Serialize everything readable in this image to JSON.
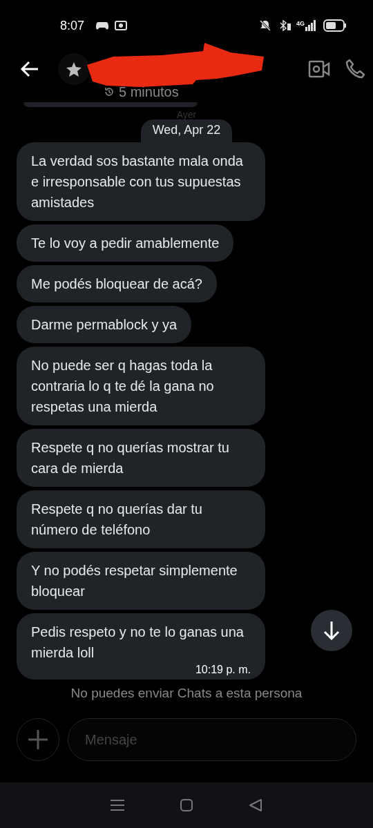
{
  "status_bar": {
    "time": "8:07",
    "network": "4G"
  },
  "header": {
    "subtitle": "5 minutos"
  },
  "date_divider": {
    "label_behind": "Ayer",
    "label": "Wed, Apr 22"
  },
  "messages": [
    {
      "text": "La verdad sos bastante mala onda e irresponsable con tus supuestas amistades"
    },
    {
      "text": "Te lo voy a pedir amablemente"
    },
    {
      "text": "Me podés bloquear de acá?"
    },
    {
      "text": "Darme permablock y ya"
    },
    {
      "text": "No puede ser q hagas toda la contraria lo q te dé la gana no respetas una mierda"
    },
    {
      "text": "Respete q no querías mostrar tu cara de mierda"
    },
    {
      "text": "Respete q no querías dar tu número de teléfono"
    },
    {
      "text": "Y no podés respetar simplemente bloquear"
    },
    {
      "text": "Pedis respeto y no te lo ganas una mierda loll",
      "time": "10:19 p. m."
    }
  ],
  "notice": "No puedes enviar Chats a esta persona",
  "composer": {
    "placeholder": "Mensaje"
  }
}
